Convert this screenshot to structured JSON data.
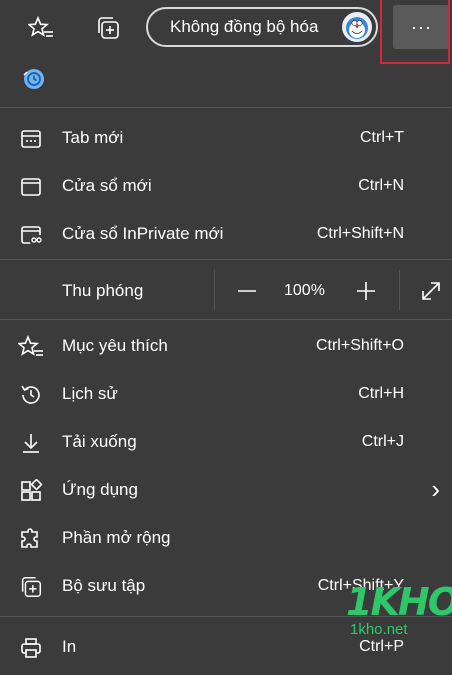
{
  "toolbar": {
    "sync_label": "Không đồng bộ hóa",
    "more_label": "···"
  },
  "menu": {
    "new_tab": {
      "label": "Tab mới",
      "shortcut": "Ctrl+T"
    },
    "new_window": {
      "label": "Cửa sổ mới",
      "shortcut": "Ctrl+N"
    },
    "new_inprivate": {
      "label": "Cửa sổ InPrivate mới",
      "shortcut": "Ctrl+Shift+N"
    },
    "zoom": {
      "label": "Thu phóng",
      "value": "100%",
      "minus": "—",
      "plus": "+"
    },
    "favorites": {
      "label": "Mục yêu thích",
      "shortcut": "Ctrl+Shift+O"
    },
    "history": {
      "label": "Lịch sử",
      "shortcut": "Ctrl+H"
    },
    "downloads": {
      "label": "Tải xuống",
      "shortcut": "Ctrl+J"
    },
    "apps": {
      "label": "Ứng dụng",
      "chevron": "›"
    },
    "extensions": {
      "label": "Phần mở rộng"
    },
    "collections": {
      "label": "Bộ sưu tập",
      "shortcut": "Ctrl+Shift+Y"
    },
    "print": {
      "label": "In",
      "shortcut": "Ctrl+P"
    }
  },
  "watermark": {
    "logo": "1KHO",
    "site": "1kho.net"
  },
  "colors": {
    "background": "#3b3b3b",
    "highlight": "#d6263a",
    "accent": "#2ec76a"
  }
}
